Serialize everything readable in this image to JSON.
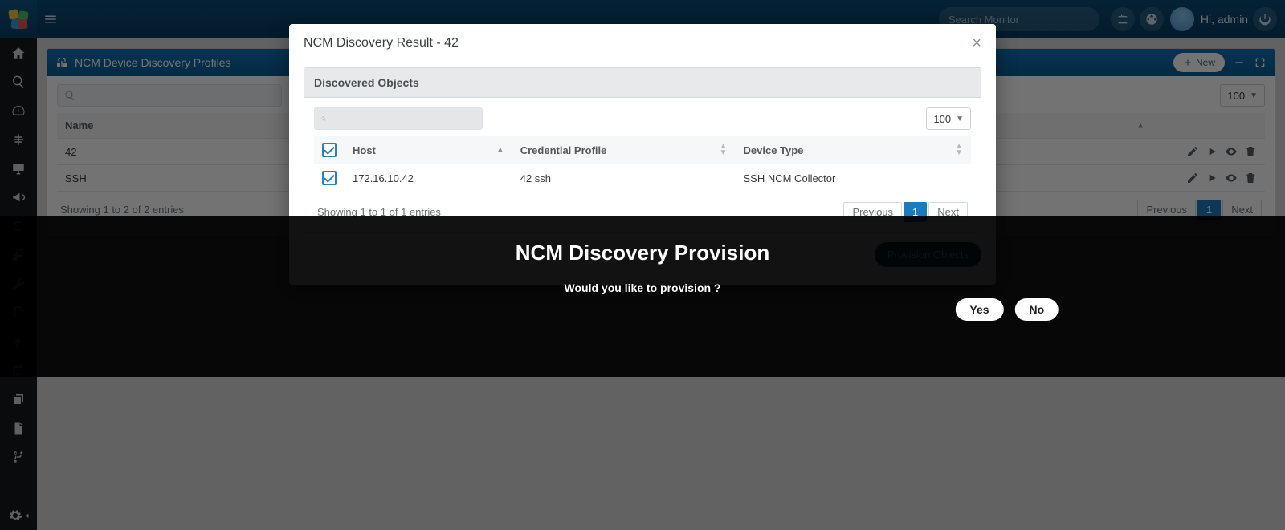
{
  "top": {
    "search_placeholder": "Search Monitor",
    "greeting": "Hi, admin"
  },
  "panel": {
    "title": "NCM Device Discovery Profiles",
    "new_label": "New",
    "page_size": "100",
    "columns": {
      "name": "Name"
    },
    "rows": [
      {
        "name": "42"
      },
      {
        "name": "SSH"
      }
    ],
    "footer_text": "Showing 1 to 2 of 2 entries",
    "pager": {
      "prev": "Previous",
      "page": "1",
      "next": "Next"
    }
  },
  "modal": {
    "title": "NCM Discovery Result - 42",
    "sub_title": "Discovered Objects",
    "page_size": "100",
    "columns": {
      "host": "Host",
      "cred": "Credential Profile",
      "type": "Device Type"
    },
    "rows": [
      {
        "host": "172.16.10.42",
        "cred": "42 ssh",
        "type": "SSH NCM Collector"
      }
    ],
    "footer_text": "Showing 1 to 1 of 1 entries",
    "pager": {
      "prev": "Previous",
      "page": "1",
      "next": "Next"
    },
    "provision_label": "Provision Objects"
  },
  "confirm": {
    "title": "NCM Discovery Provision",
    "message": "Would you like to provision ?",
    "yes": "Yes",
    "no": "No"
  }
}
